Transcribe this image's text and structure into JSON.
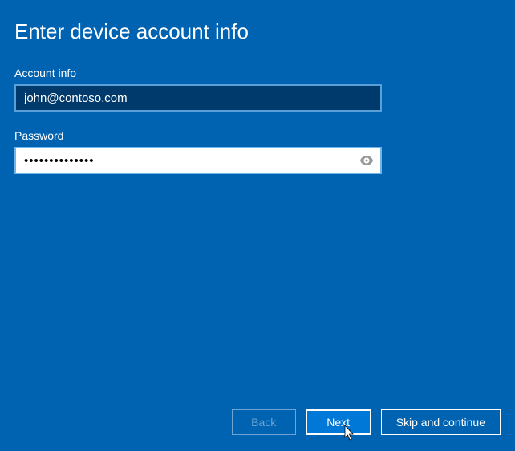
{
  "page": {
    "title": "Enter device account info"
  },
  "fields": {
    "account": {
      "label": "Account info",
      "value": "john@contoso.com"
    },
    "password": {
      "label": "Password",
      "value": "••••••••••••••"
    }
  },
  "buttons": {
    "back": "Back",
    "next": "Next",
    "skip": "Skip and continue"
  }
}
